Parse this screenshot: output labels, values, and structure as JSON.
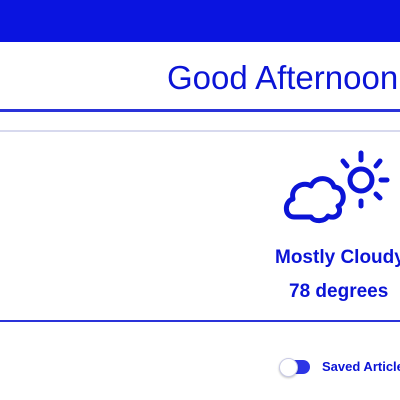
{
  "header": {
    "greeting": "Good Afternoon"
  },
  "weather": {
    "icon": "partly-cloudy-icon",
    "condition": "Mostly Cloudy",
    "temperature": "78 degrees"
  },
  "saved_articles": {
    "label": "Saved Articles",
    "enabled": true
  },
  "colors": {
    "accent": "#0a14e0",
    "text": "#0b14d6",
    "divider": "#2a33d9"
  }
}
